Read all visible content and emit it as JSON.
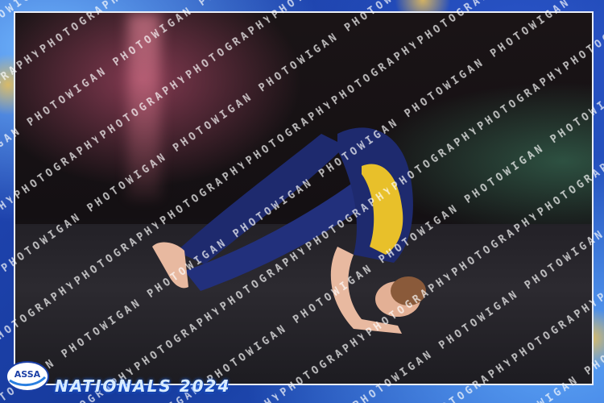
{
  "event": {
    "title": "NATIONALS 2024",
    "logo_text": "ASSA"
  },
  "watermark": {
    "text": "WIGAN PHOTOGRAPHY"
  },
  "colors": {
    "frame_blue": "#1b3fa6",
    "leotard_navy": "#1e2a6e",
    "leotard_yellow": "#e8c02a",
    "stage_black": "#141013"
  },
  "scene": {
    "subject": "dancer"
  }
}
